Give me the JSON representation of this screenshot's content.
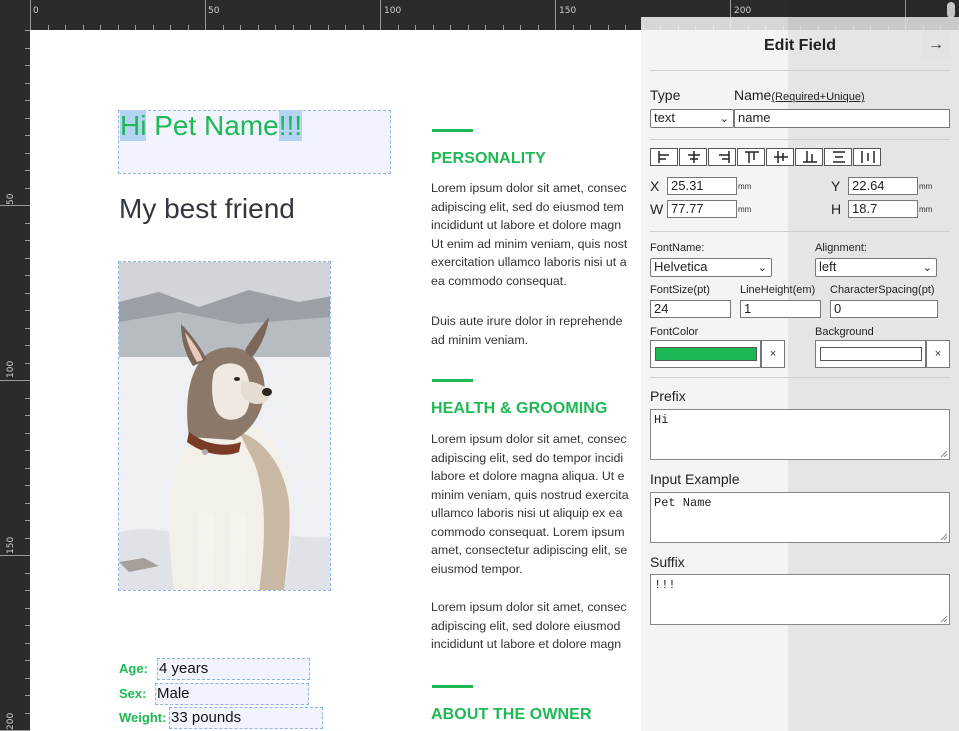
{
  "ruler": {
    "top_labels": [
      "0",
      "50",
      "100",
      "150",
      "200"
    ],
    "left_labels": [
      "50",
      "100",
      "150",
      "200"
    ]
  },
  "document": {
    "title": {
      "prefix": "Hi",
      "input": "Pet Name",
      "suffix": "!!!"
    },
    "subtitle": "My best friend",
    "photo_alt": "dog-photo",
    "stats": [
      {
        "label": "Age:",
        "value": "4 years"
      },
      {
        "label": "Sex:",
        "value": "Male"
      },
      {
        "label": "Weight:",
        "value": "33 pounds"
      }
    ],
    "sections": [
      {
        "heading": "PERSONALITY",
        "paragraphs": [
          "Lorem ipsum dolor sit amet, consec\nadipiscing elit, sed do eiusmod tem\nincididunt ut labore et dolore magn\nUt enim ad minim veniam, quis nost\nexercitation ullamco laboris nisi ut a\nea commodo consequat.",
          "Duis aute irure dolor in reprehende\nad minim veniam."
        ]
      },
      {
        "heading": "HEALTH & GROOMING",
        "paragraphs": [
          "Lorem ipsum dolor sit amet, consec\nadipiscing elit, sed do tempor incidi\nlabore et dolore magna aliqua. Ut e\nminim veniam, quis nostrud exercita\nullamco laboris nisi ut aliquip ex ea\ncommodo consequat. Lorem ipsum\namet, consectetur adipiscing elit, se\neiusmod tempor.",
          "Lorem ipsum dolor sit amet, consec\nadipiscing elit, sed dolore eiusmod\nincididunt ut labore et dolore magn"
        ]
      },
      {
        "heading": "ABOUT THE OWNER",
        "paragraphs": []
      }
    ],
    "accent_color": "#1db954"
  },
  "panel": {
    "title": "Edit Field",
    "close_icon": "arrow-right-icon",
    "type_label": "Type",
    "type_value": "text",
    "name_label": "Name",
    "name_hint": "(Required+Unique)",
    "name_value": "name",
    "align_buttons": [
      "align-left-icon",
      "align-center-h-icon",
      "align-right-icon",
      "align-top-icon",
      "align-middle-v-icon",
      "align-bottom-icon",
      "distribute-v-icon",
      "distribute-h-icon"
    ],
    "x_label": "X",
    "x_value": "25.31",
    "y_label": "Y",
    "y_value": "22.64",
    "w_label": "W",
    "w_value": "77.77",
    "h_label": "H",
    "h_value": "18.7",
    "unit": "mm",
    "font_name_label": "FontName:",
    "font_name_value": "Helvetica",
    "alignment_label": "Alignment:",
    "alignment_value": "left",
    "font_size_label": "FontSize(pt)",
    "font_size_value": "24",
    "line_height_label": "LineHeight(em)",
    "line_height_value": "1",
    "char_spacing_label": "CharacterSpacing(pt)",
    "char_spacing_value": "0",
    "font_color_label": "FontColor",
    "font_color_value": "#1db954",
    "background_label": "Background",
    "background_value": "#ffffff",
    "clear_glyph": "×",
    "prefix_label": "Prefix",
    "prefix_value": "Hi",
    "input_example_label": "Input Example",
    "input_example_value": "Pet Name",
    "suffix_label": "Suffix",
    "suffix_value": "!!!"
  }
}
